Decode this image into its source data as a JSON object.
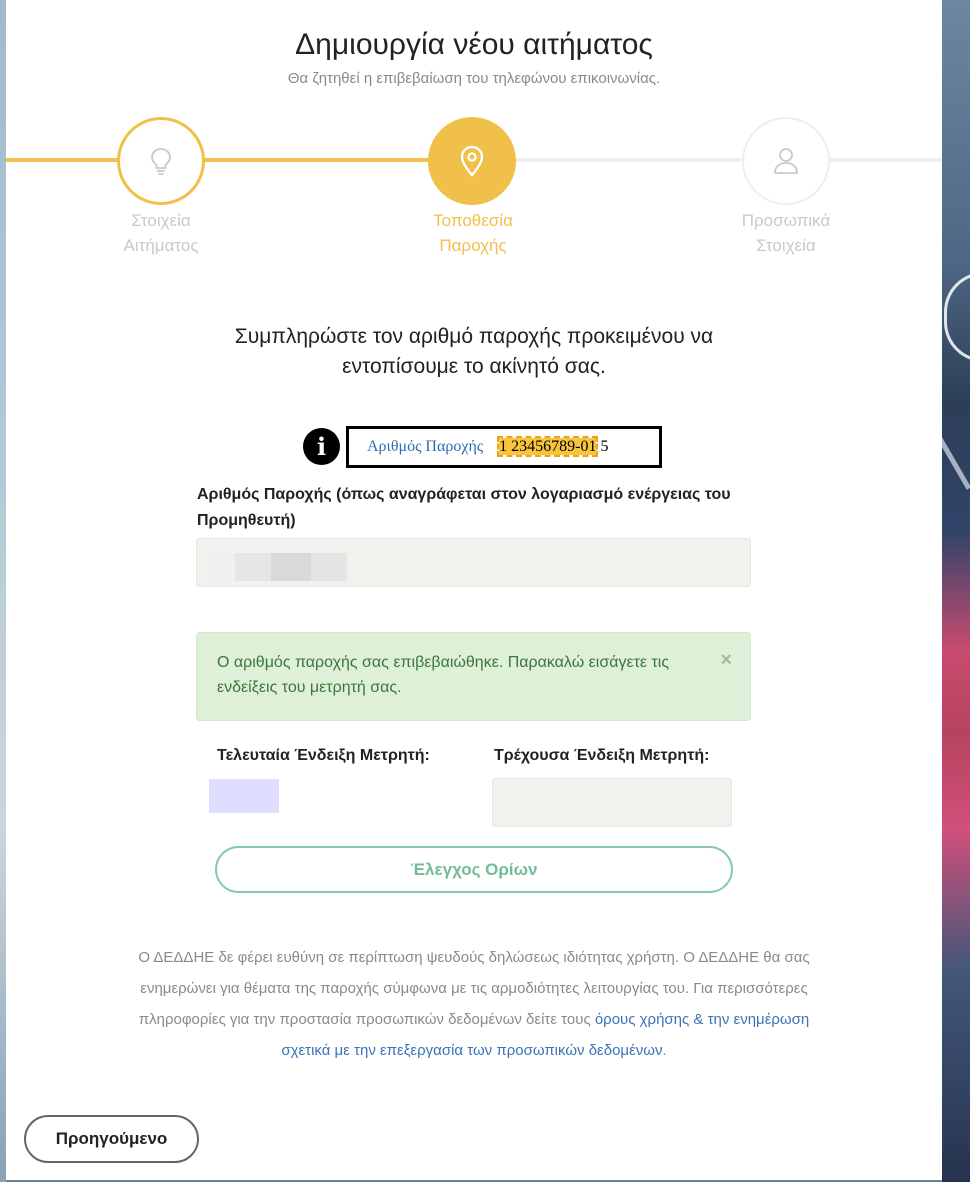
{
  "header": {
    "title": "Δημιουργία νέου αιτήματος",
    "subtitle": "Θα ζητηθεί η επιβεβαίωση του τηλεφώνου επικοινωνίας."
  },
  "stepper": {
    "steps": [
      {
        "line1": "Στοιχεία",
        "line2": "Αιτήματος",
        "icon": "lightbulb-icon",
        "state": "done"
      },
      {
        "line1": "Τοποθεσία",
        "line2": "Παροχής",
        "icon": "map-pin-icon",
        "state": "active"
      },
      {
        "line1": "Προσωπικά",
        "line2": "Στοιχεία",
        "icon": "user-icon",
        "state": "pending"
      }
    ],
    "colors": {
      "accent": "#f0c04a",
      "inactive": "#c9c9c9"
    }
  },
  "main": {
    "prompt": "Συμπληρώστε τον αριθμό παροχής προκειμένου να εντοπίσουμε το ακίνητό σας.",
    "info": {
      "label": "Αριθμός Παροχής",
      "number_highlighted": "1 23456789-01",
      "number_suffix": " 5"
    },
    "supply_field_label": "Αριθμός Παροχής (όπως αναγράφεται στον λογαριασμό ενέργειας του Προμηθευτή)",
    "alert": {
      "message": "Ο αριθμός παροχής σας επιβεβαιώθηκε. Παρακαλώ εισάγετε τις ενδείξεις του μετρητή σας.",
      "close": "×"
    },
    "meter": {
      "last_label": "Τελευταία Ένδειξη Μετρητή:",
      "current_label": "Τρέχουσα Ένδειξη Μετρητή:"
    },
    "check_button": "Έλεγχος Ορίων"
  },
  "disclaimer": {
    "text": "Ο ΔΕΔΔΗΕ δε φέρει ευθύνη σε περίπτωση ψευδούς δηλώσεως ιδιότητας χρήστη. Ο ΔΕΔΔΗΕ θα σας ενημερώνει για θέματα της παροχής σύμφωνα με τις αρμοδιότητες λειτουργίας του. Για περισσότερες πληροφορίες για την προστασία προσωπικών δεδομένων δείτε τους ",
    "terms_link": "όρους χρήσης",
    "joiner": " & ",
    "privacy_link": "την ενημέρωση σχετικά με την επεξεργασία των προσωπικών δεδομένων",
    "end": "."
  },
  "footer": {
    "prev_button": "Προηγούμενο"
  }
}
